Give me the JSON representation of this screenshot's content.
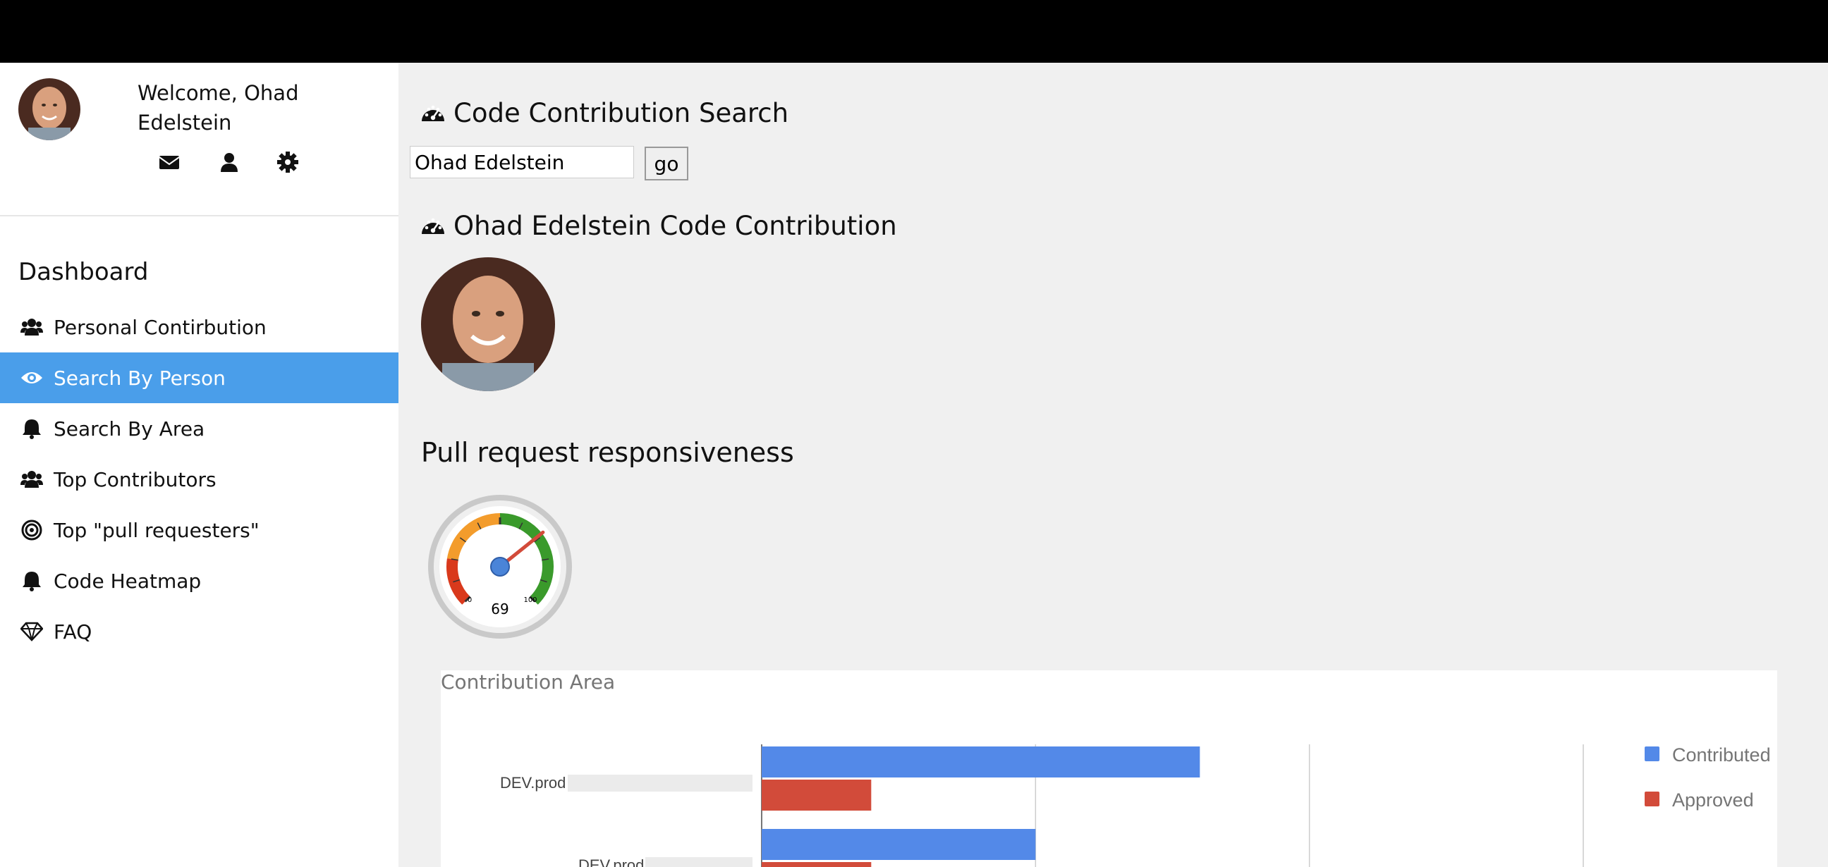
{
  "user": {
    "welcome_prefix": "Welcome,",
    "name_first": "Ohad",
    "name_last": "Edelstein"
  },
  "profile_icons": [
    "envelope-icon",
    "user-icon",
    "gear-icon"
  ],
  "sidebar": {
    "title": "Dashboard",
    "items": [
      {
        "label": "Personal Contirbution",
        "icon": "users-icon"
      },
      {
        "label": "Search By Person",
        "icon": "eye-icon",
        "active": true
      },
      {
        "label": "Search By Area",
        "icon": "bell-icon"
      },
      {
        "label": "Top Contributors",
        "icon": "users-icon"
      },
      {
        "label": "Top \"pull requesters\"",
        "icon": "target-icon"
      },
      {
        "label": "Code Heatmap",
        "icon": "bell-icon"
      },
      {
        "label": "FAQ",
        "icon": "diamond-icon"
      }
    ]
  },
  "search": {
    "title": "Code Contribution Search",
    "value": "Ohad Edelstein",
    "go_label": "go"
  },
  "result": {
    "title": "Ohad Edelstein Code Contribution"
  },
  "pr": {
    "title": "Pull request responsiveness",
    "gauge_value": 69,
    "gauge_min": 0,
    "gauge_max": 100
  },
  "colors": {
    "accent": "#4a9eea",
    "contributed": "#5389e8",
    "approved": "#d24b3a",
    "gauge_red": "#d9391c",
    "gauge_orange": "#f39c2c",
    "gauge_green": "#3a9a2b"
  },
  "chart_data": {
    "type": "bar",
    "orientation": "horizontal",
    "title": "Contribution Area",
    "categories": [
      "DEV.prod",
      "DEV.prod"
    ],
    "series": [
      {
        "name": "Contributed",
        "values": [
          1.6,
          1.0
        ]
      },
      {
        "name": "Approved",
        "values": [
          0.4,
          0.4
        ]
      }
    ],
    "xlim": [
      0,
      3
    ],
    "grid": true,
    "legend": "right"
  }
}
